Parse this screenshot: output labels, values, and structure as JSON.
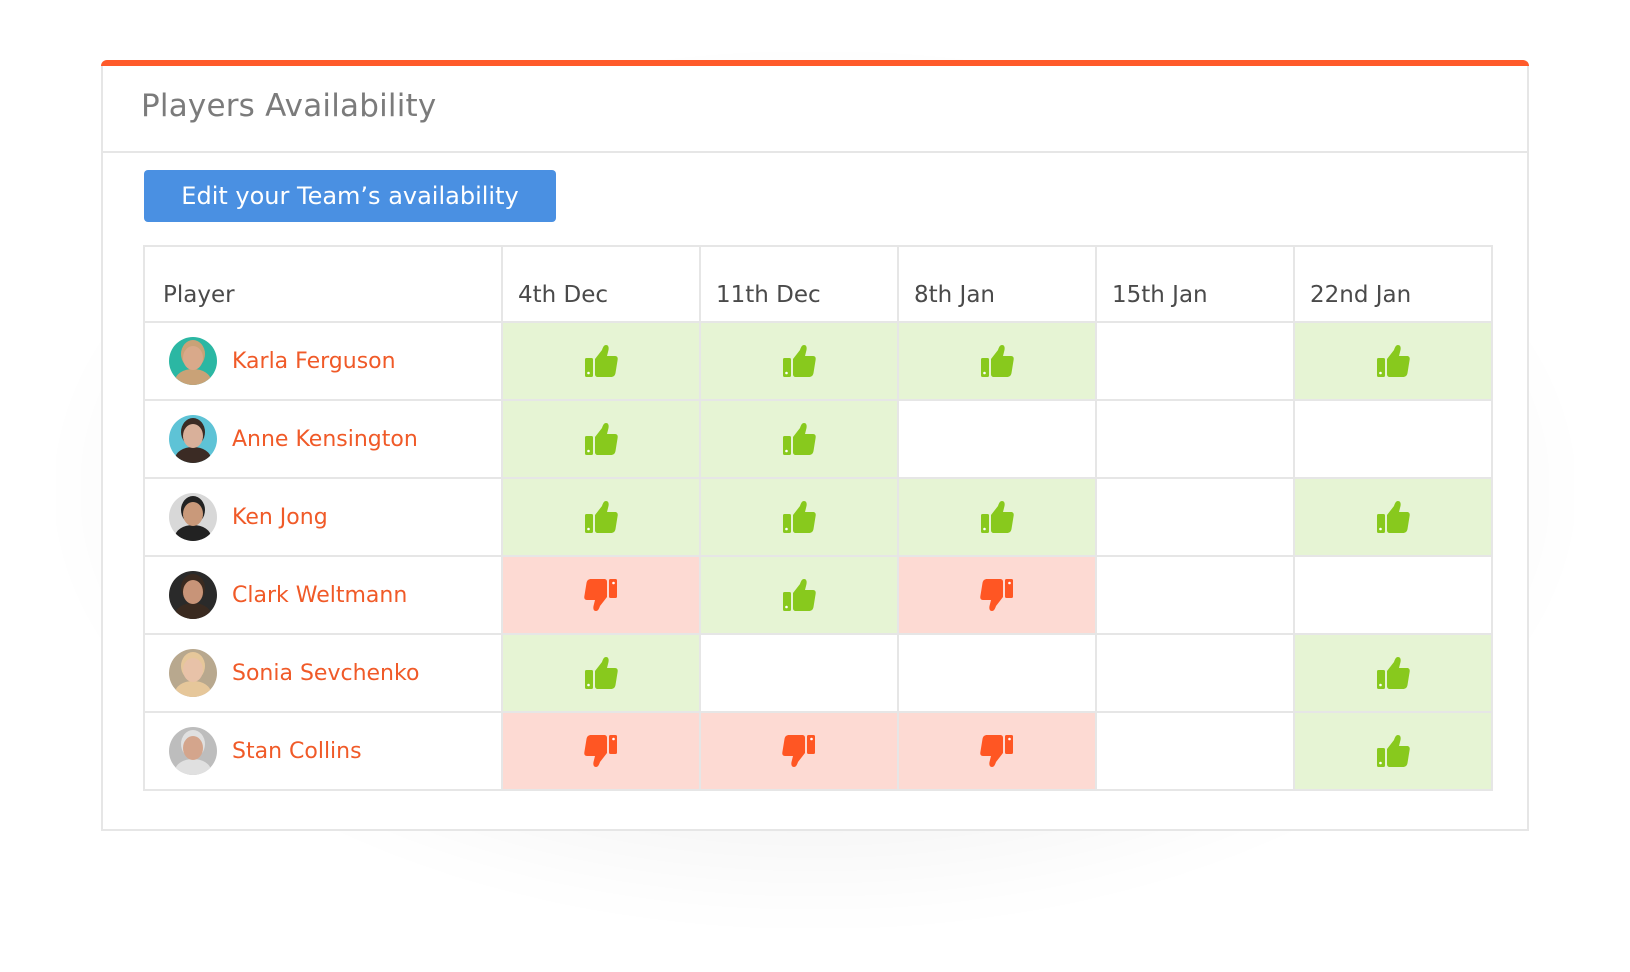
{
  "colors": {
    "accent_bar": "#ff5a2a",
    "button_bg": "#4a90e2",
    "player_name": "#f05a28",
    "available_icon": "#88c91d",
    "available_bg": "#e6f4d4",
    "unavailable_icon": "#ff5623",
    "unavailable_bg": "#fddad3"
  },
  "card": {
    "title": "Players Availability",
    "edit_button_label": "Edit your Team’s availability"
  },
  "table": {
    "player_header": "Player",
    "dates": [
      "4th Dec",
      "11th Dec",
      "8th Jan",
      "15th Jan",
      "22nd Jan"
    ],
    "rows": [
      {
        "name": "Karla Ferguson",
        "avatar": {
          "bg": "#2bb7a3",
          "skin": "#d9a98a",
          "hair": "#c9a277"
        },
        "statuses": [
          "available",
          "available",
          "available",
          "none",
          "available"
        ]
      },
      {
        "name": "Anne Kensington",
        "avatar": {
          "bg": "#5ec3d6",
          "skin": "#d9b09a",
          "hair": "#3b2b24"
        },
        "statuses": [
          "available",
          "available",
          "none",
          "none",
          "none"
        ]
      },
      {
        "name": "Ken Jong",
        "avatar": {
          "bg": "#d8d8d8",
          "skin": "#c9997a",
          "hair": "#222222"
        },
        "statuses": [
          "available",
          "available",
          "available",
          "none",
          "available"
        ]
      },
      {
        "name": "Clark Weltmann",
        "avatar": {
          "bg": "#2a2a2a",
          "skin": "#c89478",
          "hair": "#3a2a20"
        },
        "statuses": [
          "unavailable",
          "available",
          "unavailable",
          "none",
          "none"
        ]
      },
      {
        "name": "Sonia Sevchenko",
        "avatar": {
          "bg": "#b8a88e",
          "skin": "#e8c2a8",
          "hair": "#e6c79a"
        },
        "statuses": [
          "available",
          "none",
          "none",
          "none",
          "available"
        ]
      },
      {
        "name": "Stan Collins",
        "avatar": {
          "bg": "#bdbdbd",
          "skin": "#d4a58c",
          "hair": "#e0e0e0"
        },
        "statuses": [
          "unavailable",
          "unavailable",
          "unavailable",
          "none",
          "available"
        ]
      }
    ]
  },
  "icons": {
    "available": "thumbs-up-icon",
    "unavailable": "thumbs-down-icon"
  }
}
